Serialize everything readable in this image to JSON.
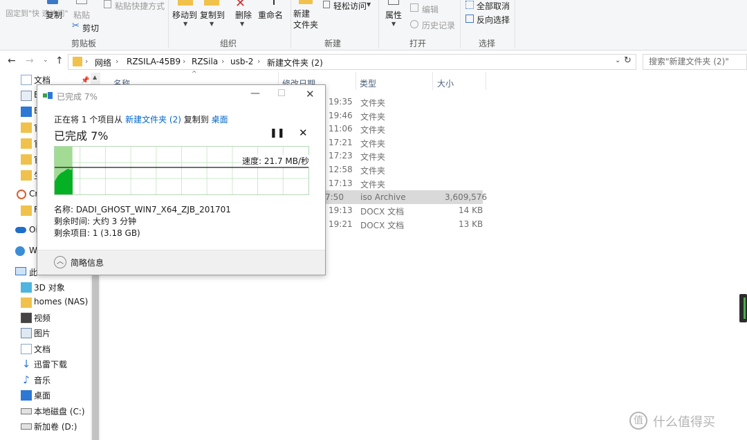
{
  "ribbon": {
    "pin_quick_access": "固定到\"快\n速访问\"",
    "copy": "复制",
    "paste": "粘贴",
    "paste_shortcut": "粘贴快捷方式",
    "cut": "剪切",
    "clipboard_group": "剪贴板",
    "move_to": "移动到",
    "copy_to": "复制到",
    "delete": "删除",
    "rename": "重命名",
    "organize_group": "组织",
    "new_folder": "新建\n文件夹",
    "easy_access": "轻松访问",
    "new_group": "新建",
    "properties": "属性",
    "edit": "编辑",
    "history": "历史记录",
    "open_group": "打开",
    "select_all": "全部取消",
    "invert_selection": "反向选择",
    "select_group": "选择"
  },
  "address": {
    "crumbs": [
      "网络",
      "RZSILA-45B9",
      "RZSila",
      "usb-2",
      "新建文件夹 (2)"
    ],
    "search_placeholder": "搜索\"新建文件夹 (2)\""
  },
  "columns": {
    "name": "名称",
    "modified": "修改日期",
    "type": "类型",
    "size": "大小"
  },
  "files": [
    {
      "time": "19:35",
      "type": "文件夹",
      "size": ""
    },
    {
      "time": "19:46",
      "type": "文件夹",
      "size": ""
    },
    {
      "time": "11:06",
      "type": "文件夹",
      "size": ""
    },
    {
      "time": "17:21",
      "type": "文件夹",
      "size": ""
    },
    {
      "time": "17:23",
      "type": "文件夹",
      "size": ""
    },
    {
      "time": "12:58",
      "type": "文件夹",
      "size": ""
    },
    {
      "time": "17:13",
      "type": "文件夹",
      "size": ""
    },
    {
      "time": "7:50",
      "type": "iso Archive",
      "size": "3,609,576"
    },
    {
      "time": "19:13",
      "type": "DOCX 文档",
      "size": "14 KB"
    },
    {
      "time": "19:21",
      "type": "DOCX 文档",
      "size": "13 KB"
    }
  ],
  "nav": {
    "top_items": [
      "文档",
      "E",
      "E",
      "官",
      "官",
      "官",
      "生",
      "Cr",
      "F",
      "Oi",
      "W",
      "此"
    ],
    "items": [
      "3D 对象",
      "homes (NAS)",
      "视频",
      "图片",
      "文档",
      "迅雷下载",
      "音乐",
      "桌面",
      "本地磁盘 (C:)",
      "新加卷 (D:)"
    ]
  },
  "dialog": {
    "title": "已完成 7%",
    "copy_prefix": "正在将 1 个项目从",
    "source": "新建文件夹 (2)",
    "copy_mid": "复制到",
    "dest": "桌面",
    "progress_text": "已完成 7%",
    "progress": 0.07,
    "speed": "速度: 21.7 MB/秒",
    "name_line": "名称: DADI_GHOST_WIN7_X64_ZJB_201701",
    "time_left": "剩余时间: 大约 3 分钟",
    "items_left": "剩余项目: 1 (3.18 GB)",
    "less_details": "简略信息"
  },
  "watermark": "值 什么值得买",
  "colors": {
    "accent_link": "#0066cc",
    "progress_green": "#06b025",
    "selected_row": "#d9d9d9"
  }
}
